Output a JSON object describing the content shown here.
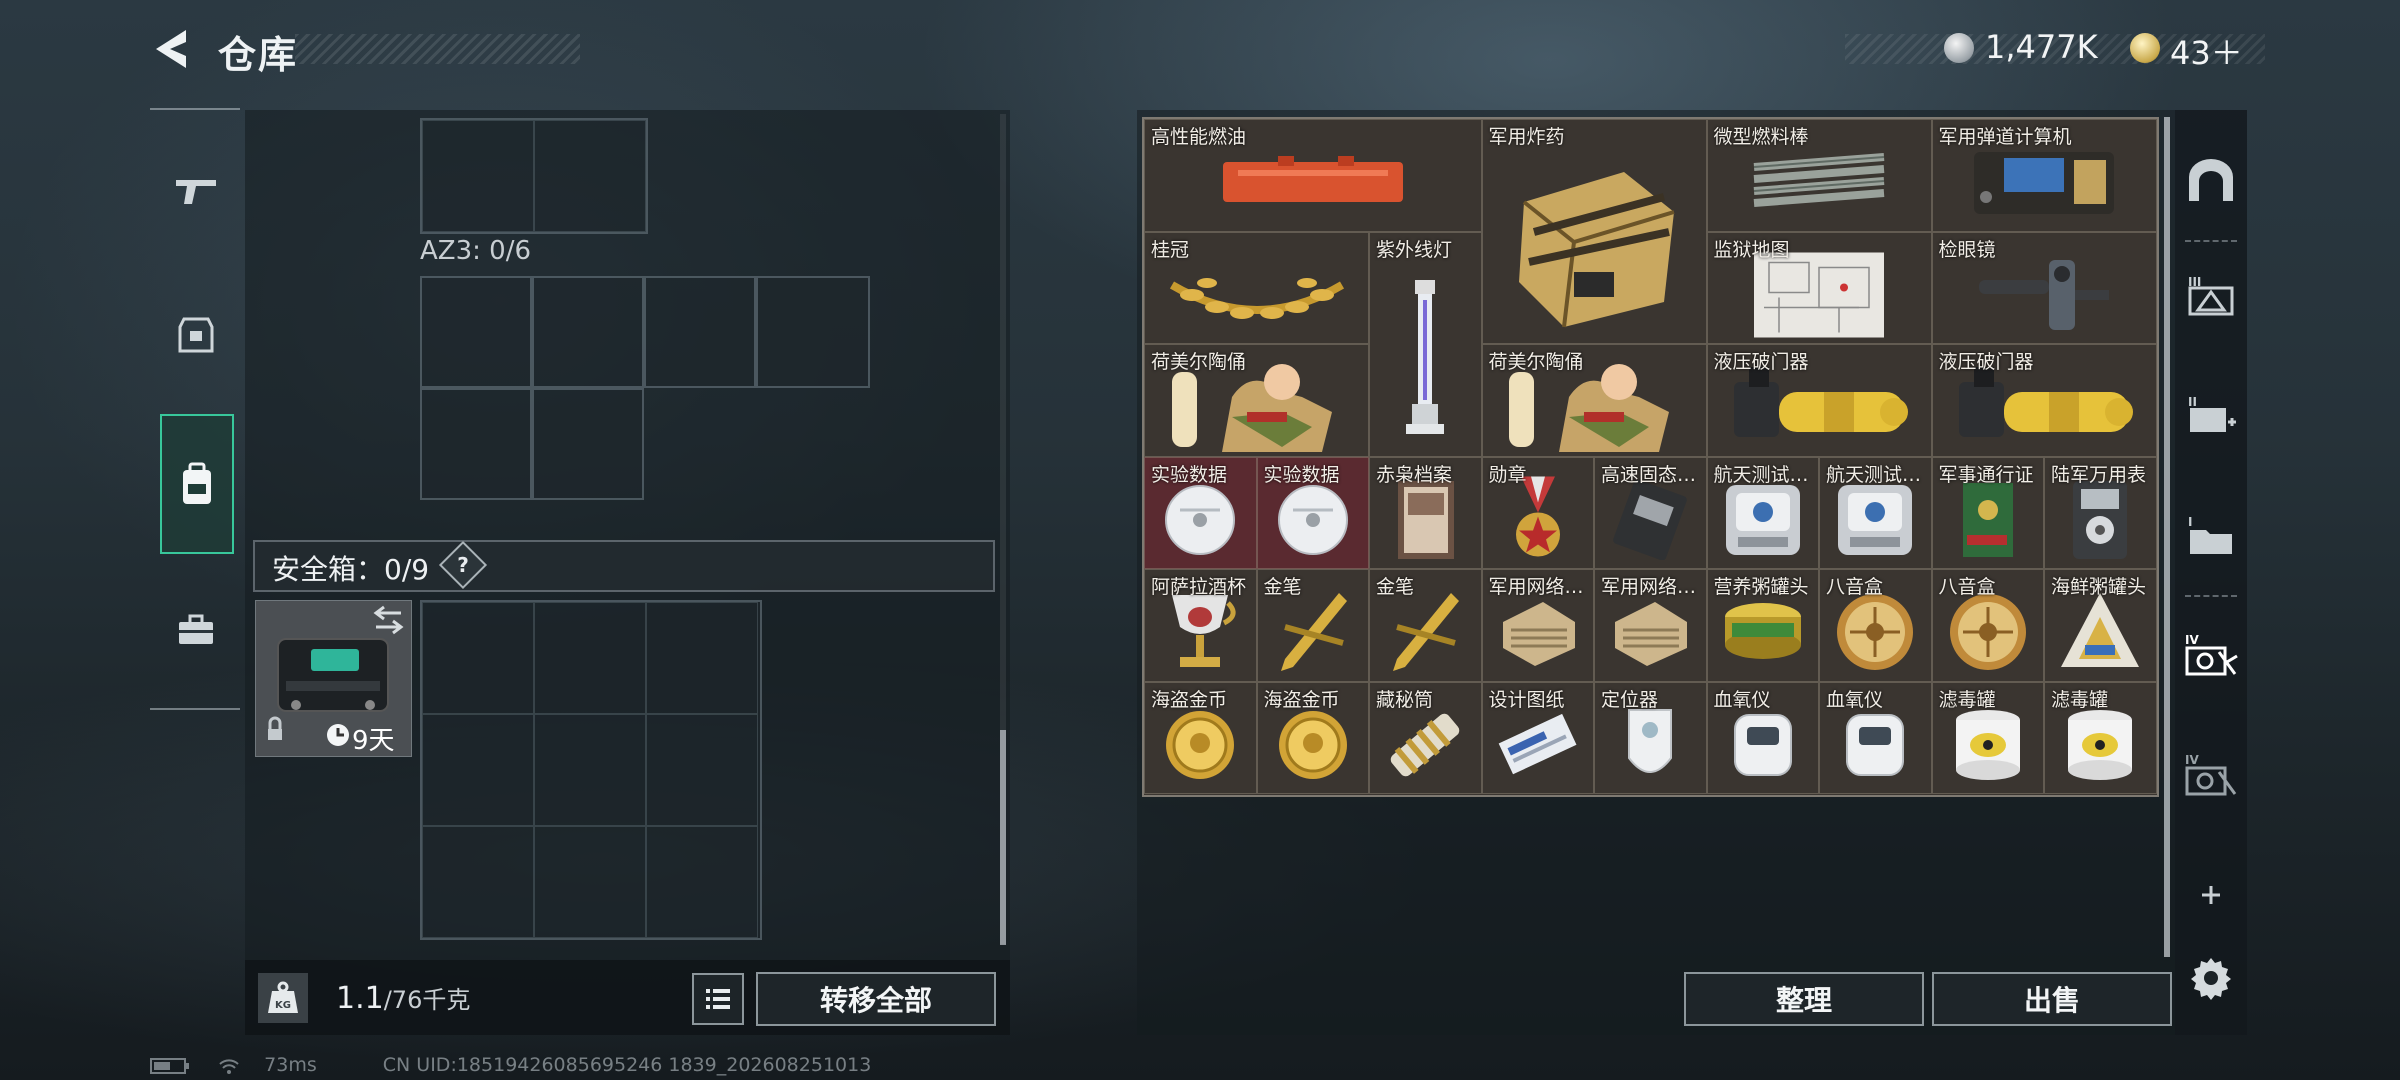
{
  "header": {
    "title": "仓库",
    "currency_1": "1,477K",
    "currency_2": "43＋"
  },
  "left_panel": {
    "az3_label": "AZ3: 0/6",
    "safe_box_label": "安全箱：0/9",
    "help_label": "?",
    "safe_case_days": "9天",
    "weight_current": "1.1",
    "weight_max": "/76千克",
    "transfer_all_label": "转移全部"
  },
  "right_panel": {
    "items": [
      {
        "name": "高性能燃油",
        "icon": "fuel-can"
      },
      {
        "name": "军用炸药",
        "icon": "explosive-crate"
      },
      {
        "name": "微型燃料棒",
        "icon": "fuel-rods"
      },
      {
        "name": "军用弹道计算机",
        "icon": "ballistic-computer"
      },
      {
        "name": "桂冠",
        "icon": "laurel-crown"
      },
      {
        "name": "紫外线灯",
        "icon": "uv-lamp"
      },
      {
        "name": "监狱地图",
        "icon": "prison-map"
      },
      {
        "name": "检眼镜",
        "icon": "ophthalmoscope"
      },
      {
        "name": "荷美尔陶俑",
        "icon": "figurine"
      },
      {
        "name": "荷美尔陶俑",
        "icon": "figurine"
      },
      {
        "name": "液压破门器",
        "icon": "hydraulic-breacher"
      },
      {
        "name": "液压破门器",
        "icon": "hydraulic-breacher"
      },
      {
        "name": "实验数据",
        "icon": "data-disc"
      },
      {
        "name": "实验数据",
        "icon": "data-disc"
      },
      {
        "name": "赤枭档案",
        "icon": "dossier"
      },
      {
        "name": "勋章",
        "icon": "medal"
      },
      {
        "name": "高速固态…",
        "icon": "ssd"
      },
      {
        "name": "航天测试…",
        "icon": "test-device"
      },
      {
        "name": "航天测试…",
        "icon": "test-device"
      },
      {
        "name": "军事通行证",
        "icon": "pass-book"
      },
      {
        "name": "陆军万用表",
        "icon": "multimeter"
      },
      {
        "name": "阿萨拉酒杯",
        "icon": "goblet"
      },
      {
        "name": "金笔",
        "icon": "gold-pen"
      },
      {
        "name": "金笔",
        "icon": "gold-pen"
      },
      {
        "name": "军用网络…",
        "icon": "network-module"
      },
      {
        "name": "军用网络…",
        "icon": "network-module"
      },
      {
        "name": "营养粥罐头",
        "icon": "can"
      },
      {
        "name": "八音盒",
        "icon": "music-box"
      },
      {
        "name": "八音盒",
        "icon": "music-box"
      },
      {
        "name": "海鲜粥罐头",
        "icon": "can-triangle"
      },
      {
        "name": "海盗金币",
        "icon": "gold-coin"
      },
      {
        "name": "海盗金币",
        "icon": "gold-coin"
      },
      {
        "name": "藏秘筒",
        "icon": "cryptex"
      },
      {
        "name": "设计图纸",
        "icon": "blueprint"
      },
      {
        "name": "定位器",
        "icon": "locator"
      },
      {
        "name": "血氧仪",
        "icon": "oximeter"
      },
      {
        "name": "血氧仪",
        "icon": "oximeter"
      },
      {
        "name": "滤毒罐",
        "icon": "filter-canister"
      },
      {
        "name": "滤毒罐",
        "icon": "filter-canister"
      }
    ],
    "sort_label": "整理",
    "sell_label": "出售"
  },
  "status_bar": {
    "ping": "73ms",
    "uid": "CN UID:18519426085695246 1839_202608251013"
  },
  "colors": {
    "accent_green": "#38c79b",
    "item_bg": "#3a3530",
    "rare_red": "#5a2a30"
  }
}
